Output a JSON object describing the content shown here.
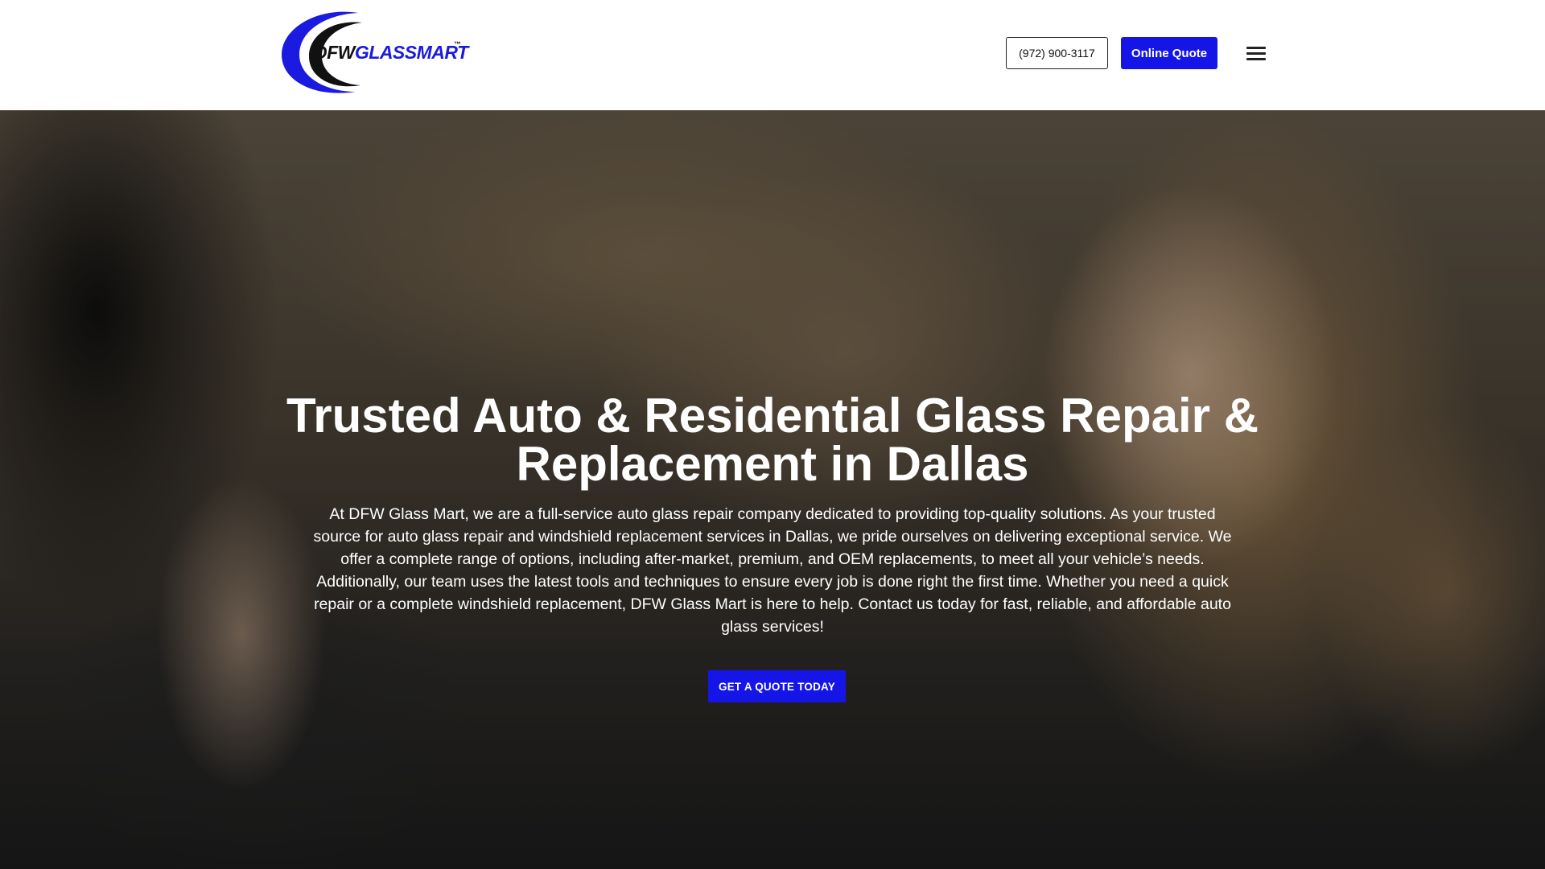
{
  "header": {
    "logo": {
      "text_part1": "DFW",
      "text_part2": "GLASSMART",
      "trademark": "™"
    },
    "phone_label": "(972) 900-3117",
    "online_quote_label": "Online Quote",
    "menu_icon": "hamburger-menu-icon"
  },
  "hero": {
    "title": "Trusted Auto & Residential Glass Repair & Replacement in Dallas",
    "body": "At DFW Glass Mart, we are a full-service auto glass repair company dedicated to providing top-quality solutions. As your trusted source for auto glass repair and windshield replacement services in Dallas, we pride ourselves on delivering exceptional service. We offer a complete range of options, including after-market, premium, and OEM replacements, to meet all your vehicle’s needs. Additionally, our team uses the latest tools and techniques to ensure every job is done right the first time. Whether you need a quick repair or a complete windshield replacement, DFW Glass Mart is here to help. Contact us today for fast, reliable, and affordable auto glass services!",
    "cta_label": "GET A QUOTE TODAY"
  },
  "colors": {
    "brand_blue": "#1515e8",
    "header_bg": "#ffffff",
    "text_dark": "#111111",
    "hero_text": "#ffffff"
  }
}
